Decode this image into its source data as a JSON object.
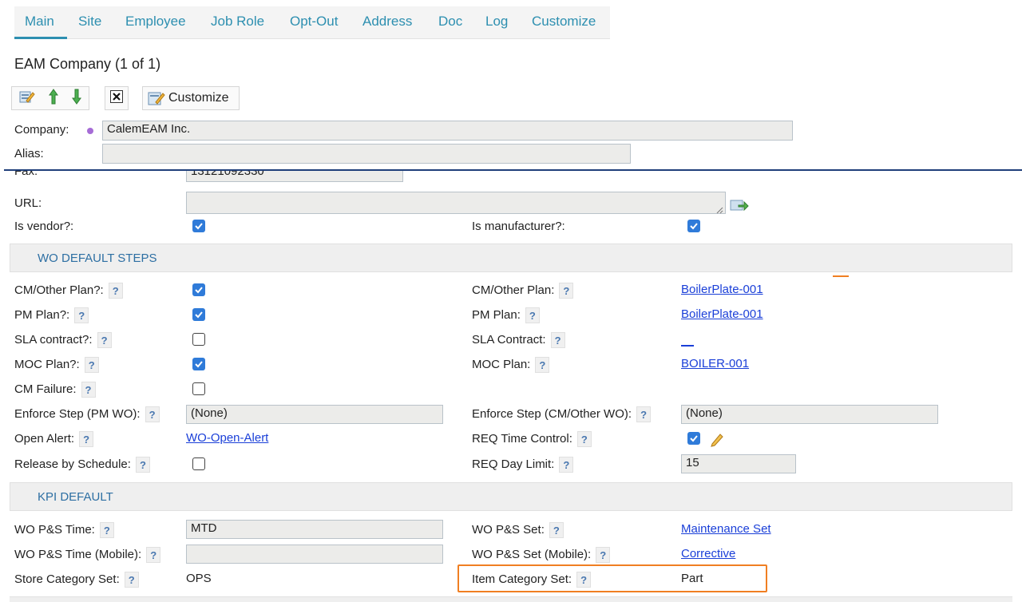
{
  "tabs": [
    "Main",
    "Site",
    "Employee",
    "Job Role",
    "Opt-Out",
    "Address",
    "Doc",
    "Log",
    "Customize"
  ],
  "title": "EAM Company (1 of 1)",
  "toolbar": {
    "customize_label": "Customize"
  },
  "header": {
    "company_label": "Company:",
    "company_value": "CalemEAM Inc.",
    "alias_label": "Alias:",
    "alias_value": ""
  },
  "contact": {
    "fax_label": "Fax:",
    "fax_value": "13121092330",
    "url_label": "URL:",
    "url_value": "",
    "vendor_label": "Is vendor?:",
    "vendor_checked": true,
    "manufacturer_label": "Is manufacturer?:",
    "manufacturer_checked": true
  },
  "help_glyph": "?",
  "wo_section": {
    "title": "WO DEFAULT STEPS",
    "cm_plan_q_label": "CM/Other Plan?:",
    "cm_plan_q_checked": true,
    "cm_plan_label": "CM/Other Plan:",
    "cm_plan_value": "BoilerPlate-001",
    "pm_plan_q_label": "PM Plan?:",
    "pm_plan_q_checked": true,
    "pm_plan_label": "PM Plan:",
    "pm_plan_value": "BoilerPlate-001",
    "sla_q_label": "SLA contract?:",
    "sla_q_checked": false,
    "sla_label": "SLA Contract:",
    "sla_value": "",
    "moc_q_label": "MOC Plan?:",
    "moc_q_checked": true,
    "moc_label": "MOC Plan:",
    "moc_value": "BOILER-001",
    "cm_failure_label": "CM Failure:",
    "cm_failure_checked": false,
    "enforce_pm_label": "Enforce Step (PM WO):",
    "enforce_pm_value": "(None)",
    "enforce_cm_label": "Enforce Step (CM/Other WO):",
    "enforce_cm_value": "(None)",
    "open_alert_label": "Open Alert:",
    "open_alert_value": "WO-Open-Alert",
    "req_time_label": "REQ Time Control:",
    "req_time_checked": true,
    "release_label": "Release by Schedule:",
    "release_checked": false,
    "req_day_label": "REQ Day Limit:",
    "req_day_value": "15"
  },
  "kpi_section": {
    "title": "KPI DEFAULT",
    "ps_time_label": "WO P&S Time:",
    "ps_time_value": "MTD",
    "ps_set_label": "WO P&S Set:",
    "ps_set_value": "Maintenance Set",
    "ps_time_mobile_label": "WO P&S Time (Mobile):",
    "ps_time_mobile_value": "",
    "ps_set_mobile_label": "WO P&S Set (Mobile):",
    "ps_set_mobile_value": "Corrective",
    "store_cat_label": "Store Category Set:",
    "store_cat_value": "OPS",
    "item_cat_label": "Item Category Set:",
    "item_cat_value": "Part"
  },
  "colors": {
    "accent": "#2d8fb0",
    "link": "#1a3fd8",
    "highlight": "#f07f22",
    "checkbox": "#2f7bd9"
  }
}
